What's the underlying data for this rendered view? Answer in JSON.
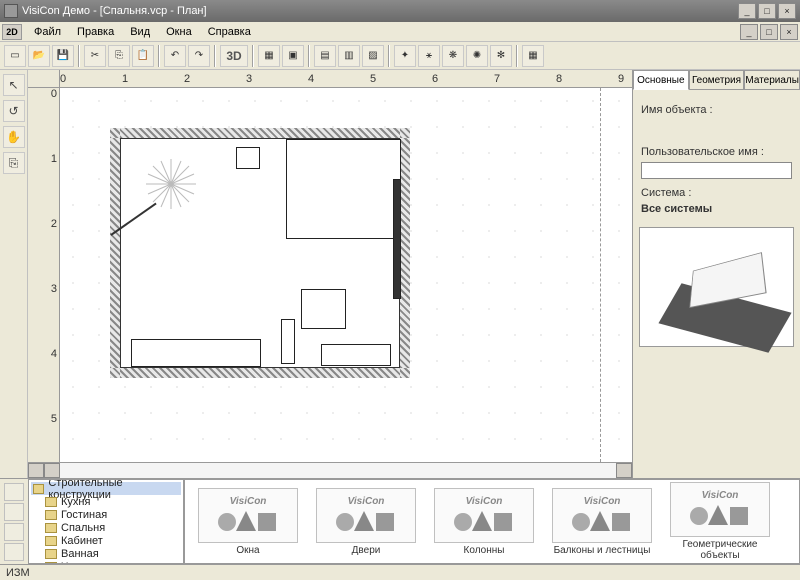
{
  "title": "VisiCon Демо - [Спальня.vcp - План]",
  "menu": {
    "md": "2D",
    "items": [
      "Файл",
      "Правка",
      "Вид",
      "Окна",
      "Справка"
    ]
  },
  "toolbar": {
    "b3d": "3D"
  },
  "ruler": {
    "h": [
      "0",
      "1",
      "2",
      "3",
      "4",
      "5",
      "6",
      "7",
      "8",
      "9"
    ],
    "v": [
      "0",
      "1",
      "2",
      "3",
      "4",
      "5"
    ]
  },
  "rpanel": {
    "tabs": [
      "Основные",
      "Геометрия",
      "Материалы"
    ],
    "objname_lbl": "Имя объекта :",
    "username_lbl": "Пользовательское имя :",
    "username_val": "",
    "system_lbl": "Система :",
    "system_val": "Все системы"
  },
  "tree": {
    "root": "Строительные конструкции",
    "items": [
      "Кухня",
      "Гостиная",
      "Спальня",
      "Кабинет",
      "Ванная",
      "Холл"
    ]
  },
  "catalog": {
    "brand": "VisiCon",
    "items": [
      "Окна",
      "Двери",
      "Колонны",
      "Балконы и лестницы",
      "Геометрические объекты"
    ]
  },
  "status": "ИЗМ"
}
